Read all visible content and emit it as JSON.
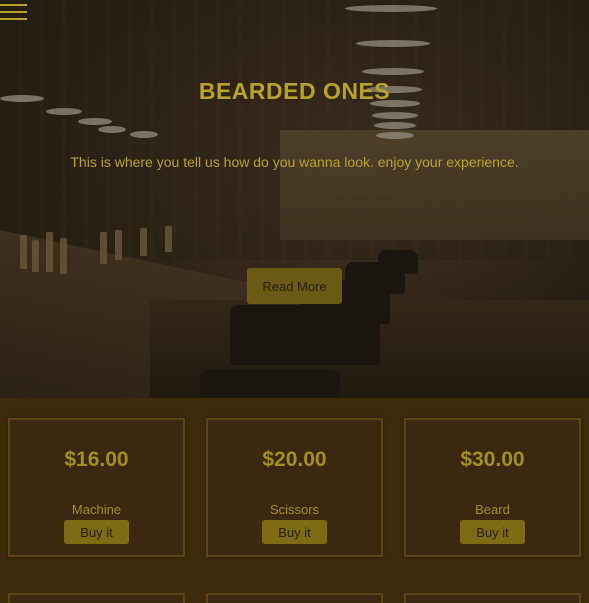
{
  "nav": {
    "menu_icon": "hamburger-menu-icon"
  },
  "hero": {
    "title": "BEARDED ONES",
    "subtitle": "This is where you tell us how do you wanna look. enjoy your experience.",
    "button_label": "Read More"
  },
  "products": [
    {
      "price": "$16.00",
      "name": "Machine",
      "button_label": "Buy it"
    },
    {
      "price": "$20.00",
      "name": "Scissors",
      "button_label": "Buy it"
    },
    {
      "price": "$30.00",
      "name": "Beard",
      "button_label": "Buy it"
    }
  ],
  "colors": {
    "accent": "#b8a22a",
    "page_background": "#3b2b0b",
    "button": "#7e6a12"
  }
}
